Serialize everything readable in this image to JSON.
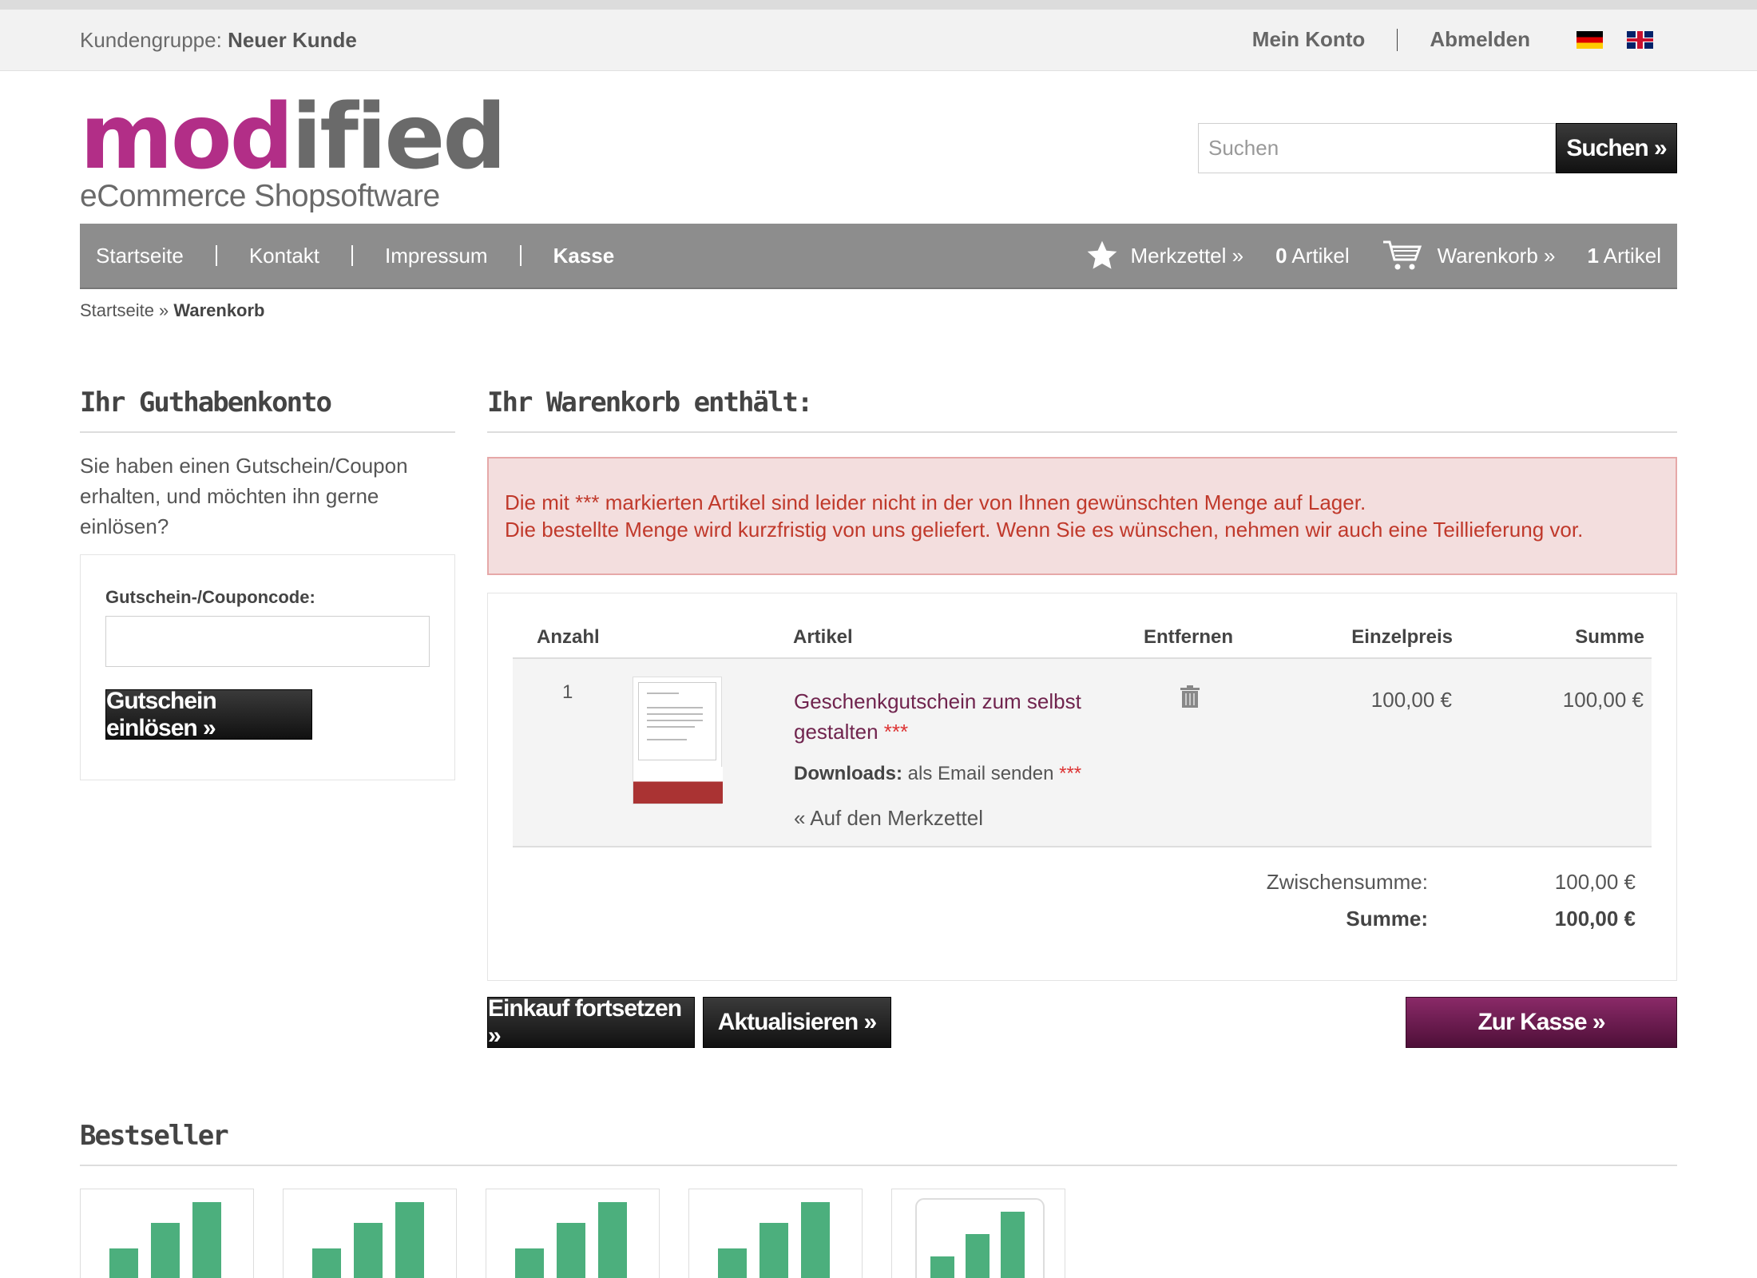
{
  "topbar": {
    "customer_group_label": "Kundengruppe:",
    "customer_group_value": "Neuer Kunde",
    "my_account": "Mein Konto",
    "logout": "Abmelden"
  },
  "logo": {
    "part1": "mod",
    "part2": "ified",
    "tagline": "eCommerce Shopsoftware"
  },
  "search": {
    "placeholder": "Suchen",
    "button": "Suchen »"
  },
  "nav": {
    "items": [
      "Startseite",
      "Kontakt",
      "Impressum",
      "Kasse"
    ],
    "wishlist": "Merkzettel »",
    "wishlist_count": "0",
    "cart": "Warenkorb »",
    "cart_count": "1",
    "articles_label": "Artikel"
  },
  "breadcrumb": {
    "home": "Startseite",
    "sep": " » ",
    "current": "Warenkorb"
  },
  "coupon": {
    "heading": "Ihr Guthabenkonto",
    "text": "Sie haben einen Gutschein/Coupon erhalten, und möchten ihn gerne einlösen?",
    "field_label": "Gutschein-/Couponcode:",
    "button": "Gutschein einlösen »"
  },
  "cart": {
    "heading": "Ihr Warenkorb enthält:",
    "alert_line1_pre": "Die mit ",
    "alert_line1_stars": "***",
    "alert_line1_post": " markierten Artikel sind leider nicht in der von Ihnen gewünschten Menge auf Lager.",
    "alert_line2": "Die bestellte Menge wird kurzfristig von uns geliefert. Wenn Sie es wünschen, nehmen wir auch eine Teillieferung vor.",
    "columns": {
      "qty": "Anzahl",
      "article": "Artikel",
      "remove": "Entfernen",
      "unit_price": "Einzelpreis",
      "total": "Summe"
    },
    "item": {
      "qty": "1",
      "name": "Geschenkgutschein zum selbst gestalten",
      "stars": "***",
      "downloads_label": "Downloads:",
      "downloads_value": "als Email senden",
      "wishlist_link": "« Auf den Merkzettel",
      "unit_price": "100,00 €",
      "total": "100,00 €"
    },
    "subtotal_label": "Zwischensumme:",
    "subtotal_value": "100,00 €",
    "total_label": "Summe:",
    "total_value": "100,00 €",
    "btn_continue": "Einkauf fortsetzen »",
    "btn_update": "Aktualisieren »",
    "btn_checkout": "Zur Kasse »"
  },
  "bestseller": {
    "heading": "Bestseller"
  },
  "colors": {
    "brand": "#b22e87",
    "nav": "#8d8d8d",
    "alert_text": "#c0392b",
    "alert_bg": "#f3dede",
    "checkout": "#6b1d52",
    "bar": "#4caf7d"
  }
}
